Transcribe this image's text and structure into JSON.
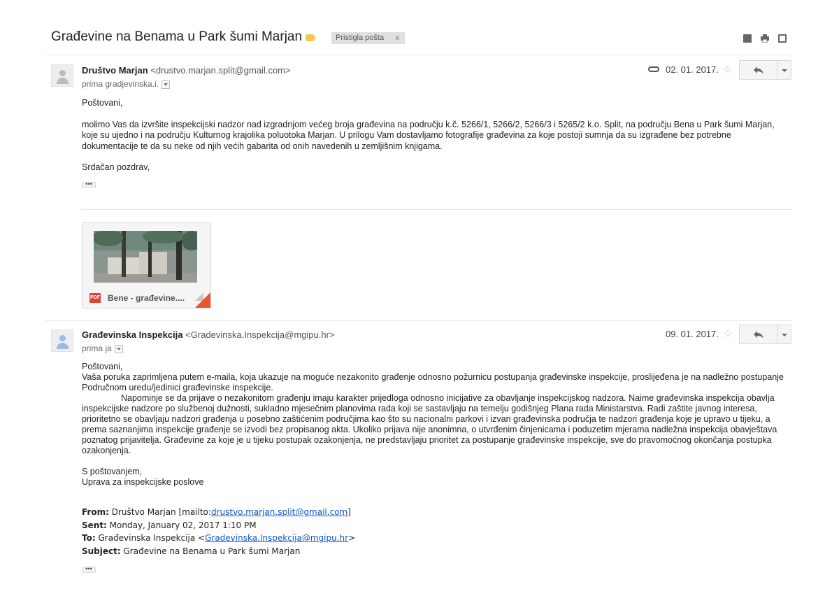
{
  "thread": {
    "subject": "Građevine na Benama u Park šumi Marjan",
    "label": "Pristigla pošta",
    "label_remove": "x"
  },
  "messages": [
    {
      "sender_name": "Društvo Marjan",
      "sender_email": "<drustvo.marjan.split@gmail.com>",
      "recipient": "prima gradjevinska.i.",
      "date": "02. 01. 2017.",
      "star": "☆",
      "greeting": "Poštovani,",
      "body": "molimo Vas da izvršite inspekcijski nadzor nad izgradnjom većeg broja građevina na području k.č. 5266/1, 5266/2, 5266/3 i 5265/2 k.o. Split, na području Bena u Park šumi Marjan, koje su ujedno i na području Kulturnog krajolika poluotoka Marjan. U prilogu Vam dostavljamo fotografije građevina za koje postoji sumnja da su izgrađene bez potrebne dokumentacije te da su neke od njih većih gabarita od onih navedenih u zemljišnim knjigama.",
      "closing": "Srdačan pozdrav,",
      "ellipsis": "•••",
      "attachment": {
        "badge": "PDF",
        "name": "Bene - građevine...."
      }
    },
    {
      "sender_name": "Građevinska Inspekcija",
      "sender_email": "<Gradevinska.Inspekcija@mgipu.hr>",
      "recipient": "prima ja",
      "date": "09. 01. 2017.",
      "star": "☆",
      "greeting": "Poštovani,",
      "para1": "Vaša poruka zaprimljena  putem e-maila, koja ukazuje na moguće nezakonito građenje odnosno požurnicu postupanja građevinske inspekcije, proslijeđena je na nadležno postupanje Područnom uredu/jedinici građevinske inspekcije.",
      "para2": "Napominje se da prijave o nezakonitom građenju imaju karakter prijedloga odnosno inicijative za obavljanje inspekcijskog nadzora. Naime građevinska inspekcija obavlja inspekcijske nadzore po službenoj dužnosti, sukladno mjesečnim planovima rada koji se sastavljaju na temelju godišnjeg Plana rada Ministarstva. Radi zaštite javnog interesa, prioritetno se obavljaju nadzori građenja u posebno zaštićenim područjima kao što su nacionalni parkovi i izvan građevinska područja te nadzori građenja koje je upravo u tijeku, a prema saznanjima inspekcije građenje se izvodi bez propisanog akta. Ukoliko prijava nije anonimna, o utvrđenim činjenicama i poduzetim mjerama nadležna inspekcija obavještava poznatog prijavitelja. Građevine za koje je u tijeku  postupak ozakonjenja, ne predstavljaju prioritet za postupanje građevinske inspekcije, sve do pravomoćnog okončanja postupka ozakonjenja.",
      "closing1": "S poštovanjem,",
      "closing2": "Uprava za inspekcijske poslove",
      "quoted": {
        "from_label": "From:",
        "from_name": " Društvo Marjan [mailto:",
        "from_email": "drustvo.marjan.split@gmail.com",
        "from_end": "]",
        "sent_label": "Sent:",
        "sent_value": " Monday, January 02, 2017 1:10 PM",
        "to_label": "To:",
        "to_name": " Građevinska Inspekcija <",
        "to_email": "Gradevinska.Inspekcija@mgipu.hr",
        "to_end": ">",
        "subject_label": "Subject:",
        "subject_value": " Građevine na Benama u Park šumi Marjan"
      },
      "ellipsis": "•••"
    }
  ],
  "icons": [
    "label-importance-icon",
    "expand-all-icon",
    "print-icon",
    "new-window-icon",
    "avatar-icon",
    "paperclip-icon",
    "star-icon",
    "reply-icon",
    "more-options-icon",
    "pdf-icon"
  ]
}
